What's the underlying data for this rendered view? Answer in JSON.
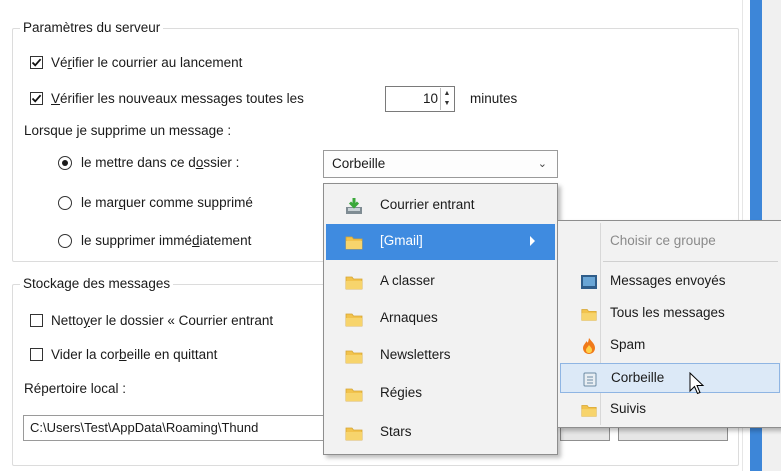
{
  "server": {
    "legend": "Paramètres du serveur",
    "check_launch": {
      "pre": "Vé",
      "ul": "r",
      "post": "ifier le courrier au lancement",
      "checked": true
    },
    "check_new": {
      "pre": "",
      "ul": "V",
      "post": "érifier les nouveaux messages toutes les",
      "checked": true
    },
    "interval_value": "10",
    "interval_unit": "minutes",
    "delete_label": "Lorsque je supprime un message :",
    "radio_folder": {
      "pre": "le mettre dans ce d",
      "ul": "o",
      "post": "ssier :",
      "selected": true
    },
    "radio_mark": {
      "pre": "le mar",
      "ul": "q",
      "post": "uer comme supprimé",
      "selected": false
    },
    "radio_delete": {
      "pre": "le supprimer immé",
      "ul": "d",
      "post": "iatement",
      "selected": false
    },
    "folder_select_value": "Corbeille"
  },
  "storage": {
    "legend": "Stockage des messages",
    "check_compact": {
      "pre": "Netto",
      "ul": "y",
      "post": "er le dossier « Courrier entrant",
      "checked": false
    },
    "check_empty": {
      "pre": "Vider la cor",
      "ul": "b",
      "post": "eille en quittant",
      "checked": false
    },
    "local_dir_label": "Répertoire local :",
    "local_dir_value": "C:\\Users\\Test\\AppData\\Roaming\\Thund"
  },
  "folder_menu": {
    "items": [
      {
        "label": "Courrier entrant",
        "icon": "inbox-download-icon"
      },
      {
        "label": "[Gmail]",
        "icon": "folder-icon",
        "selected": true,
        "has_submenu": true
      },
      {
        "label": "A classer",
        "icon": "folder-icon"
      },
      {
        "label": "Arnaques",
        "icon": "folder-icon"
      },
      {
        "label": "Newsletters",
        "icon": "folder-icon"
      },
      {
        "label": "Régies",
        "icon": "folder-icon"
      },
      {
        "label": "Stars",
        "icon": "folder-icon"
      }
    ]
  },
  "sub_menu": {
    "header": "Choisir ce groupe",
    "items": [
      {
        "label": "Messages envoyés",
        "icon": "sent-icon"
      },
      {
        "label": "Tous les messages",
        "icon": "folder-icon"
      },
      {
        "label": "Spam",
        "icon": "spam-flame-icon"
      },
      {
        "label": "Corbeille",
        "icon": "trash-icon",
        "hovered": true
      },
      {
        "label": "Suivis",
        "icon": "folder-icon"
      }
    ]
  },
  "colors": {
    "accent": "#3f8be0",
    "hover": "#dce9f7",
    "folder": "#f2c34d"
  }
}
